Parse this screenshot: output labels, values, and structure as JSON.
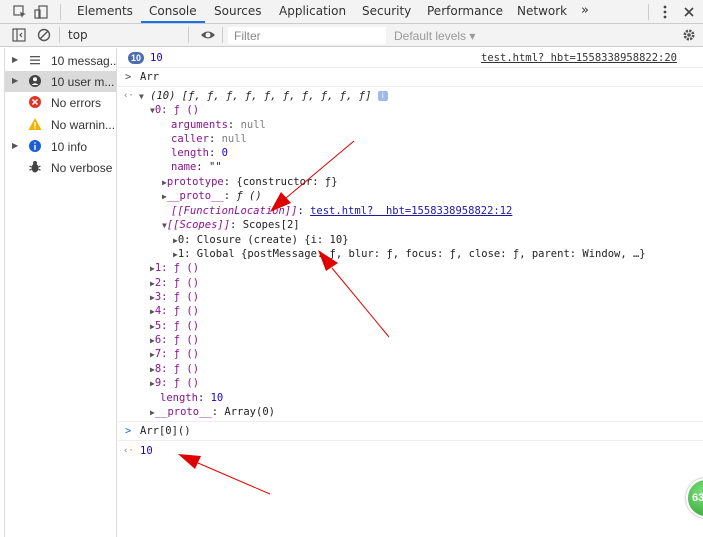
{
  "tabs": [
    {
      "label": "Elements",
      "active": false
    },
    {
      "label": "Console",
      "active": true
    },
    {
      "label": "Sources",
      "active": false
    },
    {
      "label": "Application",
      "active": false
    },
    {
      "label": "Security",
      "active": false
    },
    {
      "label": "Performance",
      "active": false
    },
    {
      "label": "Network",
      "active": false
    }
  ],
  "more_tabs": "»",
  "toolbar": {
    "context": "top",
    "filter_placeholder": "Filter",
    "levels": "Default levels ▾"
  },
  "sidebar": [
    {
      "label": "10 messag...",
      "icon": "list-icon",
      "expandable": true,
      "selected": false
    },
    {
      "label": "10 user m...",
      "icon": "user-icon",
      "expandable": true,
      "selected": true
    },
    {
      "label": "No errors",
      "icon": "error-icon",
      "expandable": false,
      "selected": false
    },
    {
      "label": "No warnin...",
      "icon": "warning-icon",
      "expandable": false,
      "selected": false
    },
    {
      "label": "10 info",
      "icon": "info-icon",
      "expandable": true,
      "selected": false
    },
    {
      "label": "No verbose",
      "icon": "bug-icon",
      "expandable": false,
      "selected": false
    }
  ],
  "console": {
    "log_badge": "10",
    "log_value": "10",
    "log_source": "test.html?  hbt=1558338958822:20",
    "input1": "Arr",
    "array_summary": "(10) [ƒ, ƒ, ƒ, ƒ, ƒ, ƒ, ƒ, ƒ, ƒ, ƒ]",
    "item0_header": "0: ƒ ()",
    "props": [
      {
        "key": "arguments",
        "value": "null"
      },
      {
        "key": "caller",
        "value": "null"
      },
      {
        "key": "length",
        "value": "0"
      },
      {
        "key": "name",
        "value": "\"\""
      }
    ],
    "prototype_key": "prototype",
    "prototype_value": "{constructor: ƒ}",
    "proto_key": "__proto__",
    "proto_value": "ƒ ()",
    "func_loc_key": "[[FunctionLocation]]",
    "func_loc_value": "test.html?  hbt=1558338958822:12",
    "scopes_key": "[[Scopes]]",
    "scopes_value": "Scopes[2]",
    "scope0": "0: Closure (create) {i: 10}",
    "scope1": "1: Global {postMessage: ƒ, blur: ƒ, focus: ƒ, close: ƒ, parent: Window, …}",
    "items": [
      "1: ƒ ()",
      "2: ƒ ()",
      "3: ƒ ()",
      "4: ƒ ()",
      "5: ƒ ()",
      "6: ƒ ()",
      "7: ƒ ()",
      "8: ƒ ()",
      "9: ƒ ()"
    ],
    "length_key": "length",
    "length_value": "10",
    "arr_proto_key": "__proto__",
    "arr_proto_value": "Array(0)",
    "input2": "Arr[0]()",
    "result2": "10"
  },
  "floating_badge": "63",
  "colors": {
    "accent": "#1a73e8",
    "annotation_arrow": "#e00000"
  }
}
